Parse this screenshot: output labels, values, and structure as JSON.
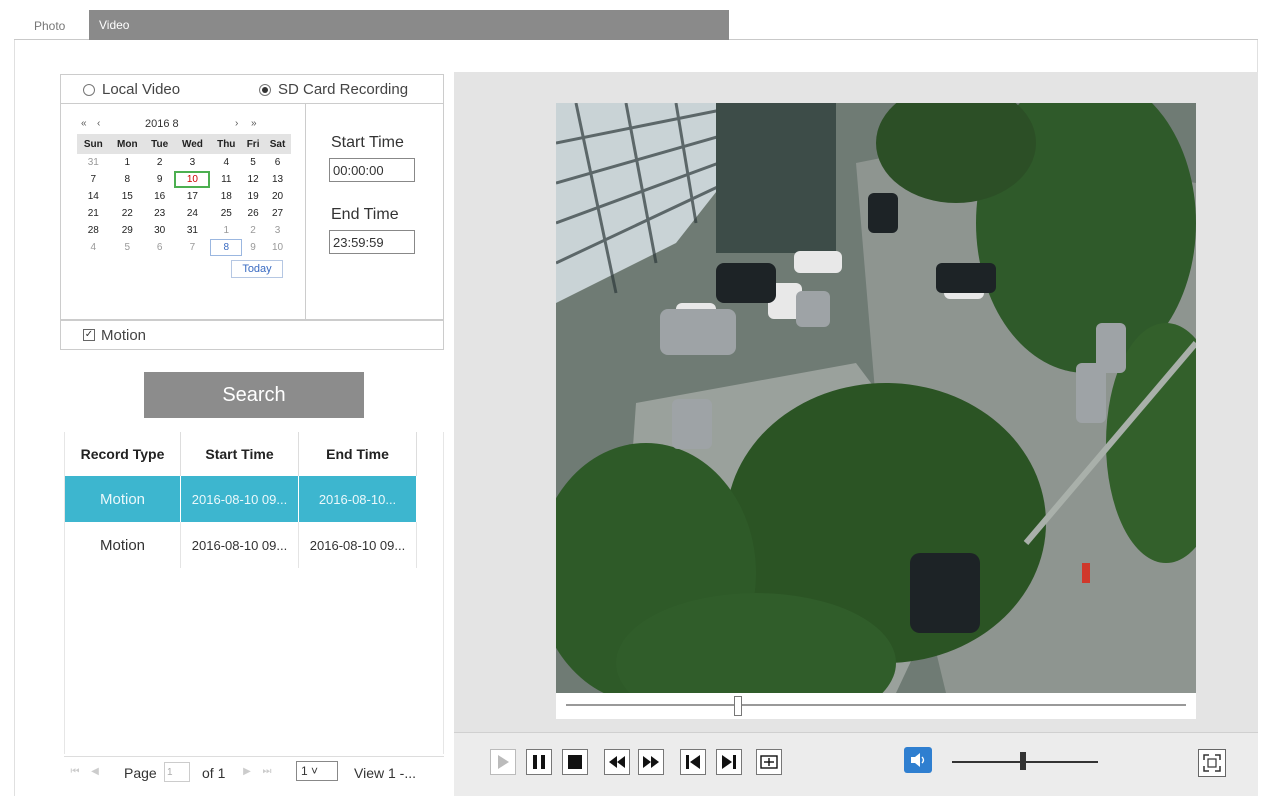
{
  "tabs": {
    "photo": "Photo",
    "video": "Video"
  },
  "source": {
    "local_label": "Local Video",
    "sd_label": "SD Card Recording",
    "selected": "sd"
  },
  "calendar": {
    "prev_year": "«",
    "prev_month": "‹",
    "next_month": "›",
    "next_year": "»",
    "year_month": "2016  8",
    "weekdays": [
      "Sun",
      "Mon",
      "Tue",
      "Wed",
      "Thu",
      "Fri",
      "Sat"
    ],
    "weeks": [
      [
        "31",
        "1",
        "2",
        "3",
        "4",
        "5",
        "6"
      ],
      [
        "7",
        "8",
        "9",
        "10",
        "11",
        "12",
        "13"
      ],
      [
        "14",
        "15",
        "16",
        "17",
        "18",
        "19",
        "20"
      ],
      [
        "21",
        "22",
        "23",
        "24",
        "25",
        "26",
        "27"
      ],
      [
        "28",
        "29",
        "30",
        "31",
        "1",
        "2",
        "3"
      ],
      [
        "4",
        "5",
        "6",
        "7",
        "8",
        "9",
        "10"
      ]
    ],
    "today_label": "Today"
  },
  "time": {
    "start_label": "Start Time",
    "start_value": "00:00:00",
    "end_label": "End Time",
    "end_value": "23:59:59"
  },
  "motion": {
    "label": "Motion",
    "checked": true
  },
  "search_label": "Search",
  "results": {
    "headers": [
      "Record Type",
      "Start Time",
      "End Time"
    ],
    "rows": [
      {
        "type": "Motion",
        "start": "2016-08-10 09...",
        "end": "2016-08-10..."
      },
      {
        "type": "Motion",
        "start": "2016-08-10 09...",
        "end": "2016-08-10 09..."
      }
    ]
  },
  "pager": {
    "page_label": "Page",
    "page_value": "1",
    "of_label": "of 1",
    "per_page": "1",
    "view_label": "View 1 -..."
  },
  "player": {
    "accent": "#2f7fd0",
    "selection_color": "#3db6cf"
  }
}
